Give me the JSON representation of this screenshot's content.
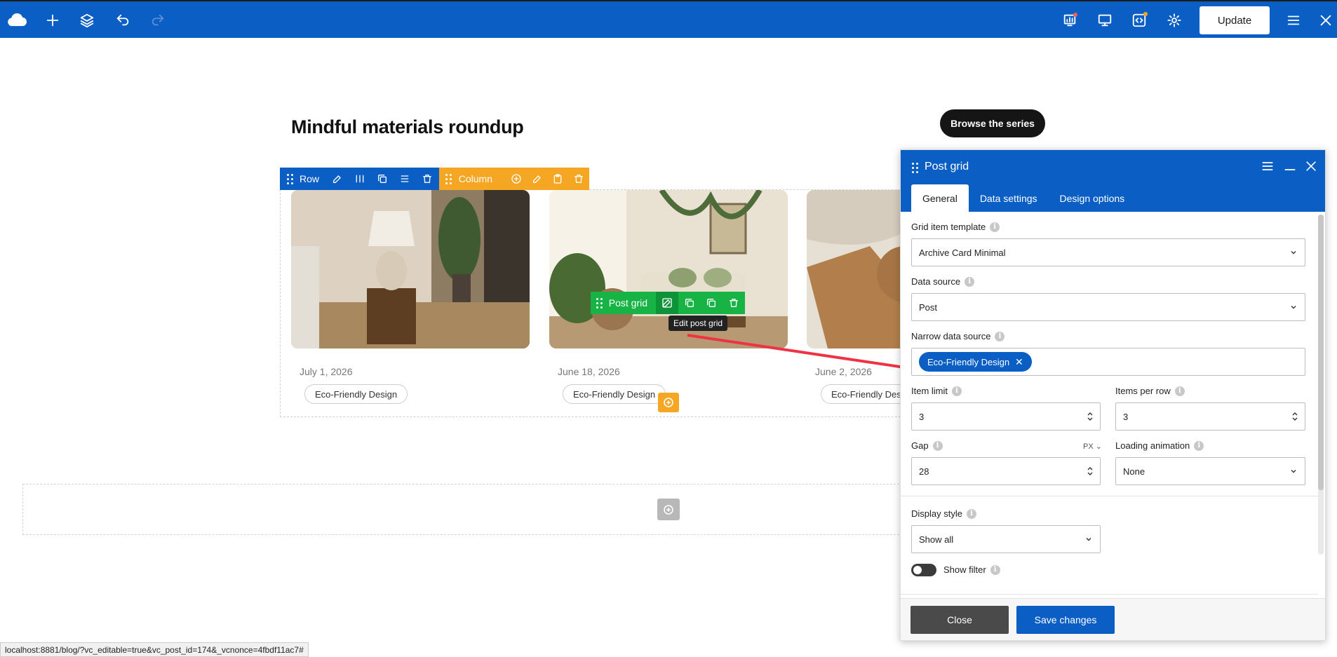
{
  "topbar": {
    "update_label": "Update",
    "icons": [
      "logo-cloud-icon",
      "add-element-icon",
      "layers-icon",
      "undo-icon",
      "redo-icon",
      "seo-icon",
      "responsive-preview-icon",
      "code-icon",
      "settings-icon",
      "menu-icon",
      "close-icon"
    ],
    "colors": {
      "bar": "#0a5ec4",
      "notify_dot_red": "#ff5a5a",
      "notify_dot_orange": "#f5a623"
    }
  },
  "page": {
    "title": "Mindful materials roundup",
    "browse_button": "Browse the series"
  },
  "controls": {
    "row_label": "Row",
    "column_label": "Column",
    "post_grid_label": "Post grid",
    "tooltip": "Edit post grid",
    "colors": {
      "row": "#0a5ec4",
      "column": "#f5a623",
      "post_grid": "#17b345"
    }
  },
  "posts": [
    {
      "date": "July 1, 2026",
      "tag": "Eco-Friendly Design"
    },
    {
      "date": "June 18, 2026",
      "tag": "Eco-Friendly Design"
    },
    {
      "date": "June 2, 2026",
      "tag": "Eco-Friendly Desi"
    }
  ],
  "panel": {
    "title": "Post grid",
    "tabs": [
      "General",
      "Data settings",
      "Design options"
    ],
    "active_tab": "General",
    "fields": {
      "grid_item_template": {
        "label": "Grid item template",
        "value": "Archive Card Minimal"
      },
      "data_source": {
        "label": "Data source",
        "value": "Post"
      },
      "narrow_data_source": {
        "label": "Narrow data source",
        "chip": "Eco-Friendly Design"
      },
      "item_limit": {
        "label": "Item limit",
        "value": "3"
      },
      "items_per_row": {
        "label": "Items per row",
        "value": "3"
      },
      "gap": {
        "label": "Gap",
        "value": "28",
        "unit": "PX"
      },
      "loading_animation": {
        "label": "Loading animation",
        "value": "None"
      },
      "display_style": {
        "label": "Display style",
        "value": "Show all"
      },
      "show_filter": {
        "label": "Show filter",
        "enabled": false
      }
    },
    "close_label": "Close",
    "save_label": "Save changes"
  },
  "status_url": "localhost:8881/blog/?vc_editable=true&vc_post_id=174&_vcnonce=4fbdf11ac7#"
}
